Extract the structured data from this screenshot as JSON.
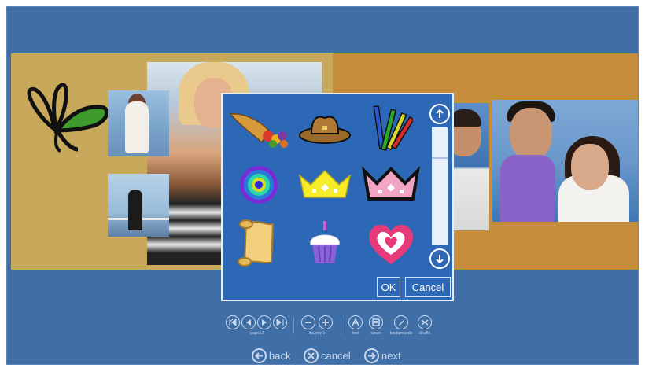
{
  "dialog": {
    "ok_label": "OK",
    "cancel_label": "Cancel",
    "stickers": [
      {
        "name": "cornucopia-sticker"
      },
      {
        "name": "cowboy-hat-sticker"
      },
      {
        "name": "pencils-sticker"
      },
      {
        "name": "rainbow-rings-sticker"
      },
      {
        "name": "yellow-crown-sticker"
      },
      {
        "name": "pink-crown-sticker"
      },
      {
        "name": "scroll-sticker"
      },
      {
        "name": "cupcake-sticker"
      },
      {
        "name": "heart-sticker"
      }
    ],
    "scroll_up_icon": "arrow-up-icon",
    "scroll_down_icon": "arrow-down-icon"
  },
  "toolbar": {
    "groups": [
      {
        "caption": "page2.1",
        "buttons": [
          "first-icon",
          "prev-icon",
          "next-play-icon",
          "last-icon"
        ]
      },
      {
        "caption": "duvetry 1",
        "buttons": [
          "minus-icon",
          "plus-icon"
        ]
      },
      {
        "caption": "text",
        "buttons": [
          "text-icon"
        ]
      },
      {
        "caption": "clearn",
        "buttons": [
          "layout-icon"
        ]
      },
      {
        "caption": "backgrounds",
        "buttons": [
          "paint-icon"
        ]
      },
      {
        "caption": "shuffle",
        "buttons": [
          "shuffle-icon"
        ]
      }
    ]
  },
  "nav": {
    "back_label": "back",
    "cancel_label": "cancel",
    "next_label": "next"
  },
  "colors": {
    "frame": "#3f6fa6",
    "dialog": "#2c68b6",
    "left_page": "#c8a85a",
    "right_page": "#c58d3c"
  }
}
